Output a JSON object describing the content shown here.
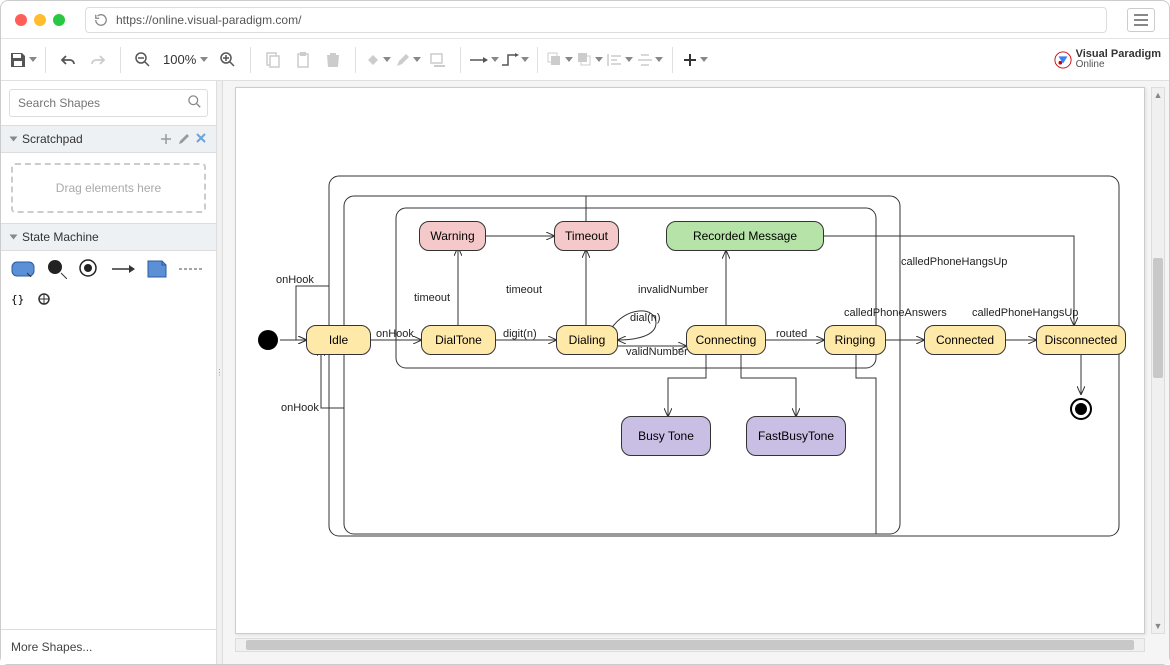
{
  "url": "https://online.visual-paradigm.com/",
  "brand": {
    "name": "Visual Paradigm",
    "sub": "Online"
  },
  "toolbar": {
    "zoom": "100%"
  },
  "sidebar": {
    "search_placeholder": "Search Shapes",
    "scratchpad_label": "Scratchpad",
    "drop_hint": "Drag elements here",
    "state_machine_label": "State Machine",
    "more_shapes": "More Shapes..."
  },
  "diagram": {
    "states": {
      "idle": "Idle",
      "dialtone": "DialTone",
      "dialing": "Dialing",
      "connecting": "Connecting",
      "ringing": "Ringing",
      "connected": "Connected",
      "disconnected": "Disconnected",
      "warning": "Warning",
      "timeout": "Timeout",
      "recorded": "Recorded Message",
      "busy": "Busy Tone",
      "fastbusy": "FastBusyTone"
    },
    "transitions": {
      "onhook1": "onHook",
      "onhook2": "onHook",
      "onhook3": "onHook",
      "timeout1": "timeout",
      "timeout2": "timeout",
      "digit": "digit(n)",
      "dial": "dial(n)",
      "invalid": "invalidNumber",
      "valid": "validNumber",
      "routed": "routed",
      "answers": "calledPhoneAnswers",
      "hangsup1": "calledPhoneHangsUp",
      "hangsup2": "calledPhoneHangsUp"
    }
  }
}
